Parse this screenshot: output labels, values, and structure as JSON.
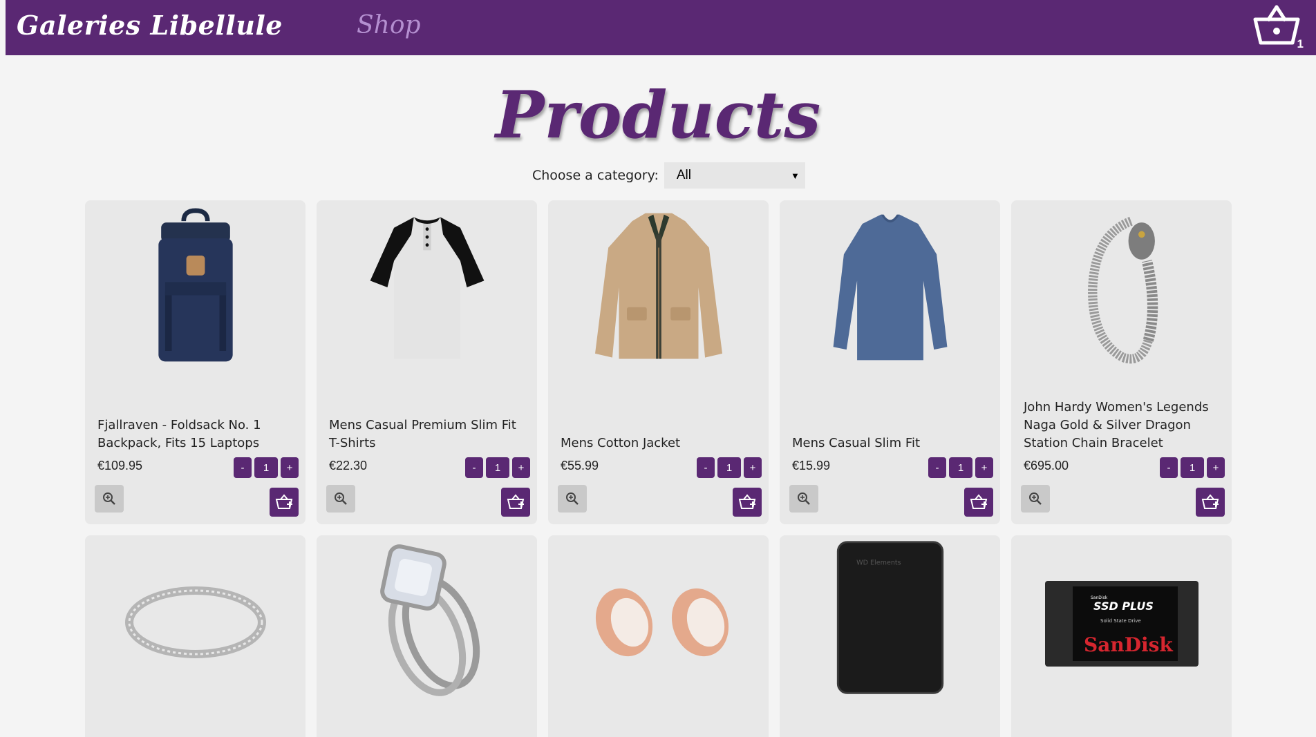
{
  "header": {
    "brand": "Galeries Libellule",
    "nav_shop": "Shop",
    "cart_count": "1",
    "bg_color": "#5a2873",
    "cart_icon": "basket-icon"
  },
  "main": {
    "title": "Products",
    "category_label": "Choose a category:",
    "category_selected": "All"
  },
  "products": [
    {
      "name": "Fjallraven - Foldsack No. 1 Backpack, Fits 15 Laptops",
      "price": "€109.95",
      "qty": "1",
      "image": "backpack"
    },
    {
      "name": "Mens Casual Premium Slim Fit T-Shirts",
      "price": "€22.30",
      "qty": "1",
      "image": "raglan-shirt"
    },
    {
      "name": "Mens Cotton Jacket",
      "price": "€55.99",
      "qty": "1",
      "image": "jacket"
    },
    {
      "name": "Mens Casual Slim Fit",
      "price": "€15.99",
      "qty": "1",
      "image": "long-sleeve-shirt"
    },
    {
      "name": "John Hardy Women's Legends Naga Gold & Silver Dragon Station Chain Bracelet",
      "price": "€695.00",
      "qty": "1",
      "image": "bracelet"
    },
    {
      "image": "silver-ring"
    },
    {
      "image": "diamond-ring"
    },
    {
      "image": "rose-gold-plugs"
    },
    {
      "image": "external-hard-drive",
      "image_text": "WD Elements"
    },
    {
      "image": "ssd",
      "image_text": [
        "SanDisk",
        "SSD PLUS",
        "Solid State Drive",
        "SanDisk"
      ]
    }
  ],
  "buttons": {
    "minus": "-",
    "plus": "+",
    "zoom_icon": "zoom-in-icon",
    "add_icon": "add-to-cart-icon"
  }
}
